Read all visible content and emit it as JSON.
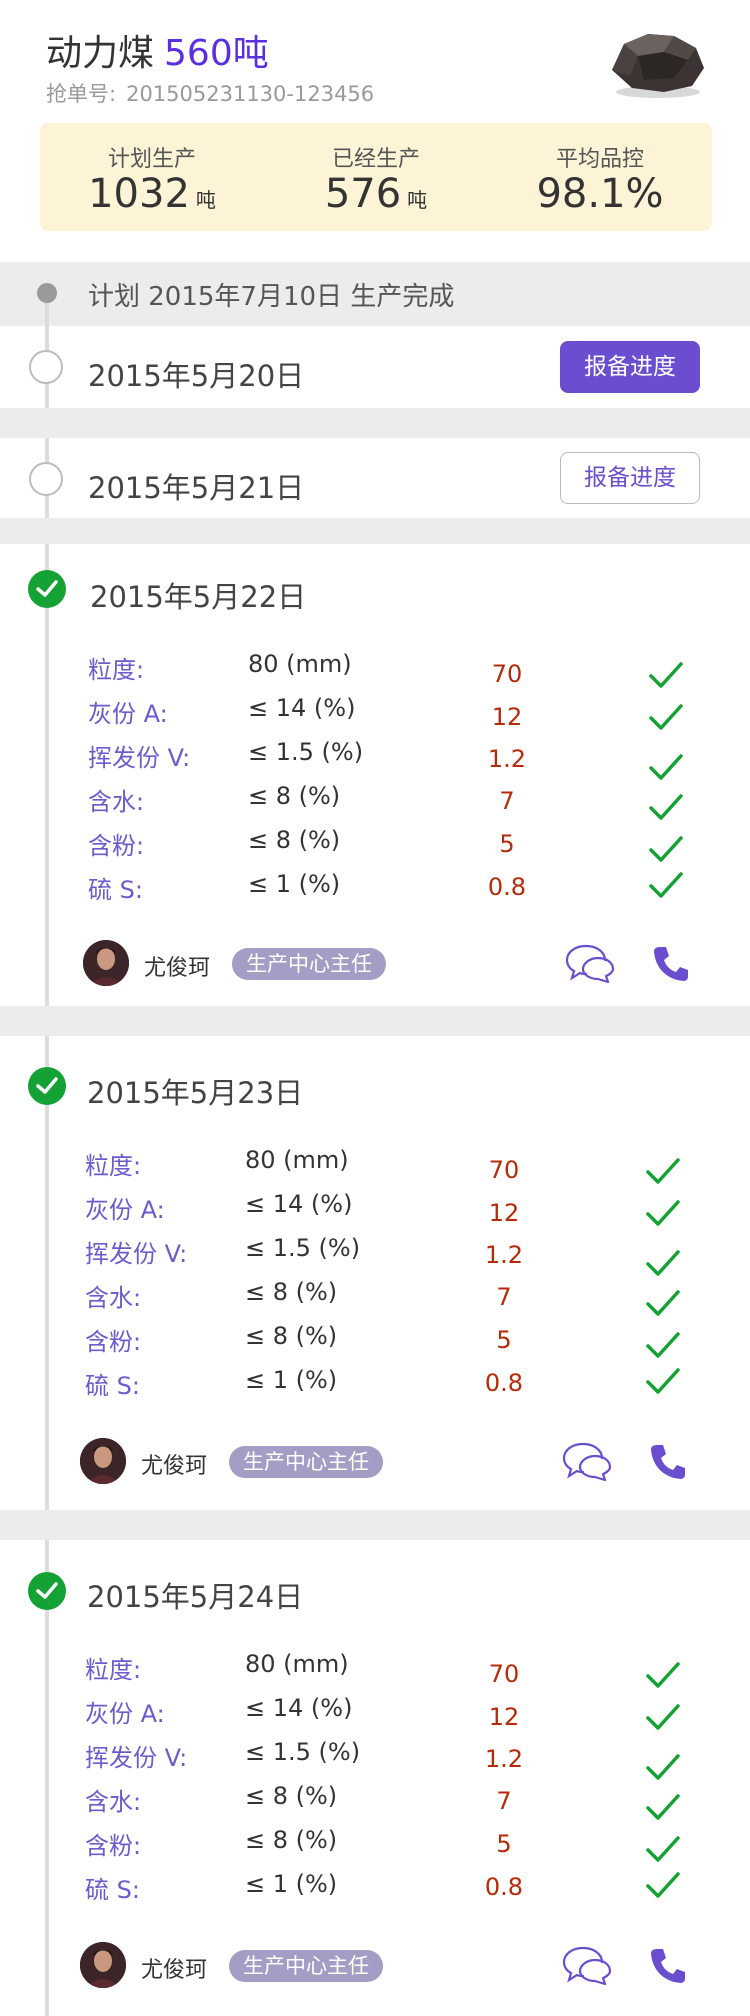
{
  "header": {
    "product": "动力煤",
    "amount": "560吨",
    "order_label": "抢单号:",
    "order_number": "201505231130-123456"
  },
  "stats": [
    {
      "label": "计划生产",
      "value": "1032",
      "unit": "吨"
    },
    {
      "label": "已经生产",
      "value": "576",
      "unit": "吨"
    },
    {
      "label": "平均品控",
      "value": "98.1%",
      "unit": ""
    }
  ],
  "plan": {
    "text": "计划 2015年7月10日 生产完成"
  },
  "pending": [
    {
      "date": "2015年5月20日",
      "button": "报备进度",
      "style": "filled"
    },
    {
      "date": "2015年5月21日",
      "button": "报备进度",
      "style": "outline"
    }
  ],
  "records": [
    {
      "date": "2015年5月22日",
      "specs": [
        {
          "label": "粒度:",
          "standard": "80 (mm)",
          "value": "70"
        },
        {
          "label": "灰份 A:",
          "standard": "≤ 14 (%)",
          "value": "12"
        },
        {
          "label": "挥发份 V:",
          "standard": "≤ 1.5 (%)",
          "value": "1.2"
        },
        {
          "label": "含水:",
          "standard": "≤ 8 (%)",
          "value": "7"
        },
        {
          "label": "含粉:",
          "standard": "≤ 8 (%)",
          "value": "5"
        },
        {
          "label": "硫 S:",
          "standard": "≤ 1 (%)",
          "value": "0.8"
        }
      ],
      "person": "尤俊珂",
      "role": "生产中心主任"
    },
    {
      "date": "2015年5月23日",
      "specs": [
        {
          "label": "粒度:",
          "standard": "80 (mm)",
          "value": "70"
        },
        {
          "label": "灰份 A:",
          "standard": "≤ 14 (%)",
          "value": "12"
        },
        {
          "label": "挥发份 V:",
          "standard": "≤ 1.5 (%)",
          "value": "1.2"
        },
        {
          "label": "含水:",
          "standard": "≤ 8 (%)",
          "value": "7"
        },
        {
          "label": "含粉:",
          "standard": "≤ 8 (%)",
          "value": "5"
        },
        {
          "label": "硫 S:",
          "standard": "≤ 1 (%)",
          "value": "0.8"
        }
      ],
      "person": "尤俊珂",
      "role": "生产中心主任"
    },
    {
      "date": "2015年5月24日",
      "specs": [
        {
          "label": "粒度:",
          "standard": "80 (mm)",
          "value": "70"
        },
        {
          "label": "灰份 A:",
          "standard": "≤ 14 (%)",
          "value": "12"
        },
        {
          "label": "挥发份 V:",
          "standard": "≤ 1.5 (%)",
          "value": "1.2"
        },
        {
          "label": "含水:",
          "standard": "≤ 8 (%)",
          "value": "7"
        },
        {
          "label": "含粉:",
          "standard": "≤ 8 (%)",
          "value": "5"
        },
        {
          "label": "硫 S:",
          "standard": "≤ 1 (%)",
          "value": "0.8"
        }
      ],
      "person": "尤俊珂",
      "role": "生产中心主任"
    }
  ],
  "colors": {
    "accent": "#6a4ecf",
    "amount": "#5b2fe0",
    "check_green": "#13a233",
    "value_red": "#b52b0a",
    "stats_bg": "#fdf3d6"
  },
  "icons": {
    "product_image": "coal-image",
    "done": "check-circle-icon",
    "pass": "checkmark-icon",
    "chat": "chat-bubbles-icon",
    "phone": "phone-icon"
  }
}
